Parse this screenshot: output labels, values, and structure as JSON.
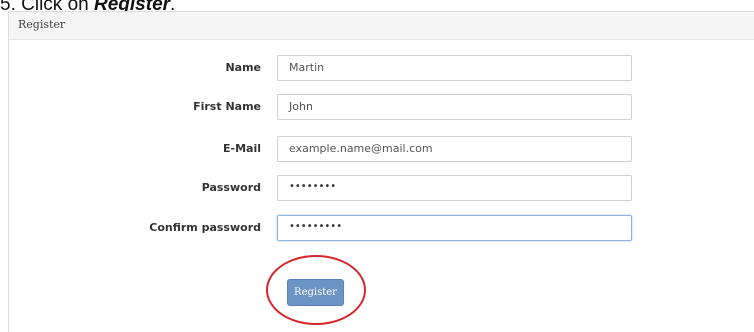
{
  "instruction": {
    "step": "5.",
    "prefix": "Click on",
    "target": "Register",
    "suffix": "."
  },
  "panel": {
    "title": "Register"
  },
  "form": {
    "fields": [
      {
        "label": "Name",
        "value": "Martin"
      },
      {
        "label": "First Name",
        "value": "John"
      },
      {
        "label": "E-Mail",
        "value": "example.name@mail.com"
      },
      {
        "label": "Password",
        "value": "••••••••"
      },
      {
        "label": "Confirm password",
        "value": "•••••••••"
      }
    ],
    "submit_label": "Register"
  },
  "colors": {
    "button": "#6b93c4",
    "highlight_circle": "#d6262c"
  }
}
